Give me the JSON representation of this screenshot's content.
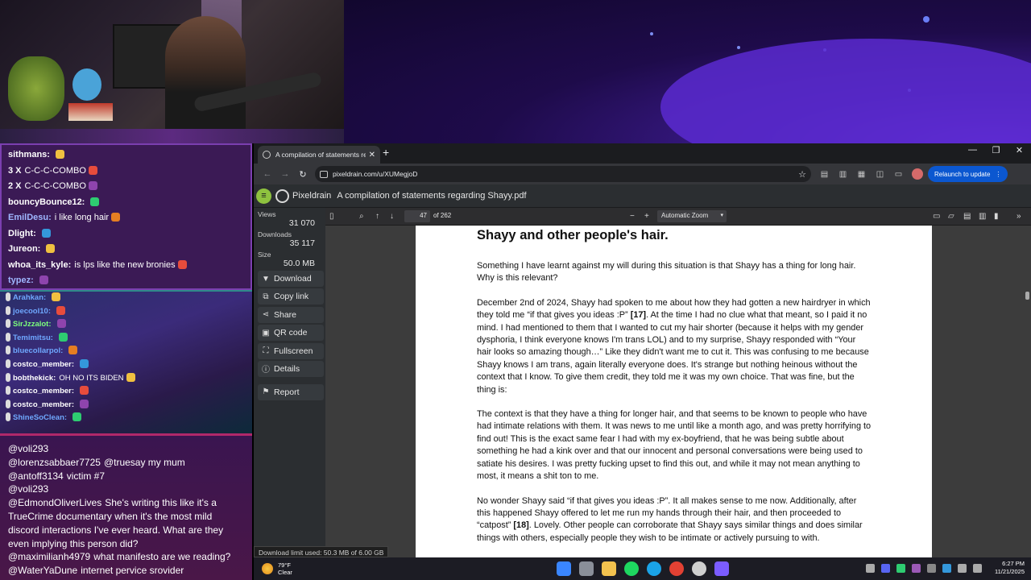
{
  "chat_top": [
    {
      "user": "sithmans:",
      "color": "#ffffff",
      "text": ""
    },
    {
      "user": "3 X",
      "color": "#ffffff",
      "text": "C-C-C-COMBO"
    },
    {
      "user": "2 X",
      "color": "#ffffff",
      "text": "C-C-C-COMBO"
    },
    {
      "user": "bouncyBounce12:",
      "color": "#ffffff",
      "text": ""
    },
    {
      "user": "EmilDesu:",
      "color": "#9fb7ff",
      "text": "i like long hair"
    },
    {
      "user": "Dlight:",
      "color": "#ffffff",
      "text": ""
    },
    {
      "user": "Jureon:",
      "color": "#ffffff",
      "text": ""
    },
    {
      "user": "whoa_its_kyle:",
      "color": "#ffffff",
      "text": "is lps like the new bronies"
    },
    {
      "user": "typez:",
      "color": "#9fb7ff",
      "text": ""
    }
  ],
  "chat_mid": [
    {
      "user": "Arahkan:",
      "color": "#6fa8ff",
      "text": ""
    },
    {
      "user": "joecool10:",
      "color": "#6fa8ff",
      "text": ""
    },
    {
      "user": "SirJzzalot:",
      "color": "#7cff7c",
      "text": ""
    },
    {
      "user": "Temimitsu:",
      "color": "#6fa8ff",
      "text": ""
    },
    {
      "user": "bluecollarpol:",
      "color": "#6fa8ff",
      "text": ""
    },
    {
      "user": "costco_member:",
      "color": "#ffffff",
      "text": ""
    },
    {
      "user": "bobthekick:",
      "color": "#ffffff",
      "text": "OH NO ITS BIDEN"
    },
    {
      "user": "costco_member:",
      "color": "#ffffff",
      "text": ""
    },
    {
      "user": "costco_member:",
      "color": "#ffffff",
      "text": ""
    },
    {
      "user": "ShineSoClean:",
      "color": "#6fa8ff",
      "text": ""
    }
  ],
  "chat_bottom": [
    {
      "user": "@voli293",
      "text": ""
    },
    {
      "user": "@lorenzsabbaer7725",
      "text": "@truesay my mum"
    },
    {
      "user": "@antoff3134",
      "text": "victim #7"
    },
    {
      "user": "@voli293",
      "text": ""
    },
    {
      "user": "@EdmondOliverLives",
      "text": "She's writing this like it's a TrueCrime documentary when it's the most mild discord interactions I've ever heard. What are they even implying this person did?"
    },
    {
      "user": "@maximilianh4979",
      "text": "what manifesto are we reading?"
    },
    {
      "user": "@WaterYaDune",
      "text": "internet pervice srovider"
    }
  ],
  "browser": {
    "tab_title": "A compilation of statements re",
    "tab_close": "✕",
    "new_tab": "+",
    "win_min": "—",
    "win_max": "❐",
    "win_close": "✕",
    "url": "pixeldrain.com/u/XUMegjoD",
    "relaunch": "Relaunch to update"
  },
  "pixeldrain": {
    "brand": "Pixeldrain",
    "filename": "A compilation of statements regarding Shayy.pdf",
    "views_label": "Views",
    "views": "31 070",
    "downloads_label": "Downloads",
    "downloads": "35 117",
    "size_label": "Size",
    "size": "50.0 MB",
    "buttons": {
      "download": "Download",
      "copy_link": "Copy link",
      "share": "Share",
      "qr": "QR code",
      "fullscreen": "Fullscreen",
      "details": "Details",
      "report": "Report"
    },
    "status": "Download limit used: 50.3 MB of 6.00 GB"
  },
  "pdf": {
    "page": "47",
    "of": "of 262",
    "zoom": "Automatic Zoom",
    "heading": "Shayy and other people's hair.",
    "p1": "Something I have learnt against my will during this situation is that Shayy has a thing for long hair. Why is this relevant?",
    "p2a": "December 2nd of 2024, Shayy had spoken to me about how they had gotten a new hairdryer in which they told me “if that gives you ideas :P” ",
    "p2ref": "[17]",
    "p2b": ". At the time I had no clue what that meant, so I paid it no mind. I had mentioned to them that I wanted to cut my hair shorter (because it helps with my gender dysphoria, I think everyone knows I'm trans LOL) and to my surprise, Shayy responded with “Your hair looks so amazing though…” Like they didn't want me to cut it. This was confusing to me because Shayy knows I am trans, again literally everyone does. It's strange but nothing heinous without the context that I know. To give them credit, they told me it was my own choice. That was fine, but the thing is:",
    "p3": "The context is that they have a thing for longer hair, and that seems to be known to people who have had intimate relations with them. It was news to me until like a month ago, and was pretty horrifying to find out! This is the exact same fear I had with my ex-boyfriend, that he was being subtle about something he had a kink over and that our innocent and personal conversations were being used to satiate his desires. I was pretty fucking upset to find this out, and while it may not mean anything to most, it means a shit ton to me.",
    "p4a": "No wonder Shayy said “if that gives you ideas :P”. It all makes sense to me now. Additionally, after this happened Shayy offered to let me run my hands through their hair, and then proceeded to “catpost” ",
    "p4ref": "[18]",
    "p4b": ". Lovely. Other people can corroborate that Shayy says similar things and does similar things with others, especially people they wish to be intimate or actively pursuing to with."
  },
  "taskbar": {
    "temp": "79°F",
    "cond": "Clear",
    "time": "6:27 PM",
    "date": "11/21/2025"
  },
  "colors": {
    "pixeldrain_accent": "#8ec23f",
    "relaunch": "#0b57d0",
    "chat_border": "#b0286a"
  }
}
